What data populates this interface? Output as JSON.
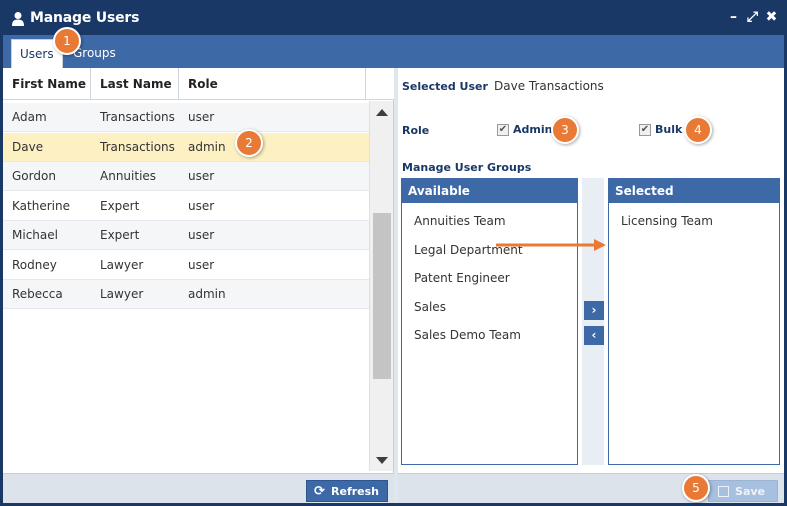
{
  "window": {
    "title": "Manage Users"
  },
  "tabs": [
    {
      "label": "Users"
    },
    {
      "label": "Groups"
    }
  ],
  "grid": {
    "columns": [
      "First Name",
      "Last Name",
      "Role"
    ],
    "rows": [
      {
        "first": "Adam",
        "last": "Transactions",
        "role": "user"
      },
      {
        "first": "Dave",
        "last": "Transactions",
        "role": "admin"
      },
      {
        "first": "Gordon",
        "last": "Annuities",
        "role": "user"
      },
      {
        "first": "Katherine",
        "last": "Expert",
        "role": "user"
      },
      {
        "first": "Michael",
        "last": "Expert",
        "role": "user"
      },
      {
        "first": "Rodney",
        "last": "Lawyer",
        "role": "user"
      },
      {
        "first": "Rebecca",
        "last": "Lawyer",
        "role": "admin"
      }
    ],
    "selected_row": 1
  },
  "left_footer": {
    "refresh_label": "Refresh"
  },
  "detail": {
    "selected_user_label": "Selected User",
    "selected_user_value": "Dave Transactions",
    "role_label": "Role",
    "admin_label": "Admin",
    "bulk_label": "Bulk",
    "admin_checked": true,
    "bulk_checked": true,
    "manage_groups_label": "Manage User Groups"
  },
  "available": {
    "header": "Available",
    "items": [
      "Annuities Team",
      "Legal Department",
      "Patent Engineer",
      "Sales",
      "Sales Demo Team"
    ]
  },
  "selected_groups": {
    "header": "Selected",
    "items": [
      "Licensing Team"
    ]
  },
  "mover": {
    "move_right": "›",
    "move_left": "‹"
  },
  "right_footer": {
    "save_label": "Save"
  },
  "callouts": [
    "1",
    "2",
    "3",
    "4",
    "5"
  ],
  "colors": {
    "titlebar": "#1a3866",
    "accent": "#3d69a7",
    "selected_row": "#fdf0c2",
    "callout": "#e97a35"
  }
}
